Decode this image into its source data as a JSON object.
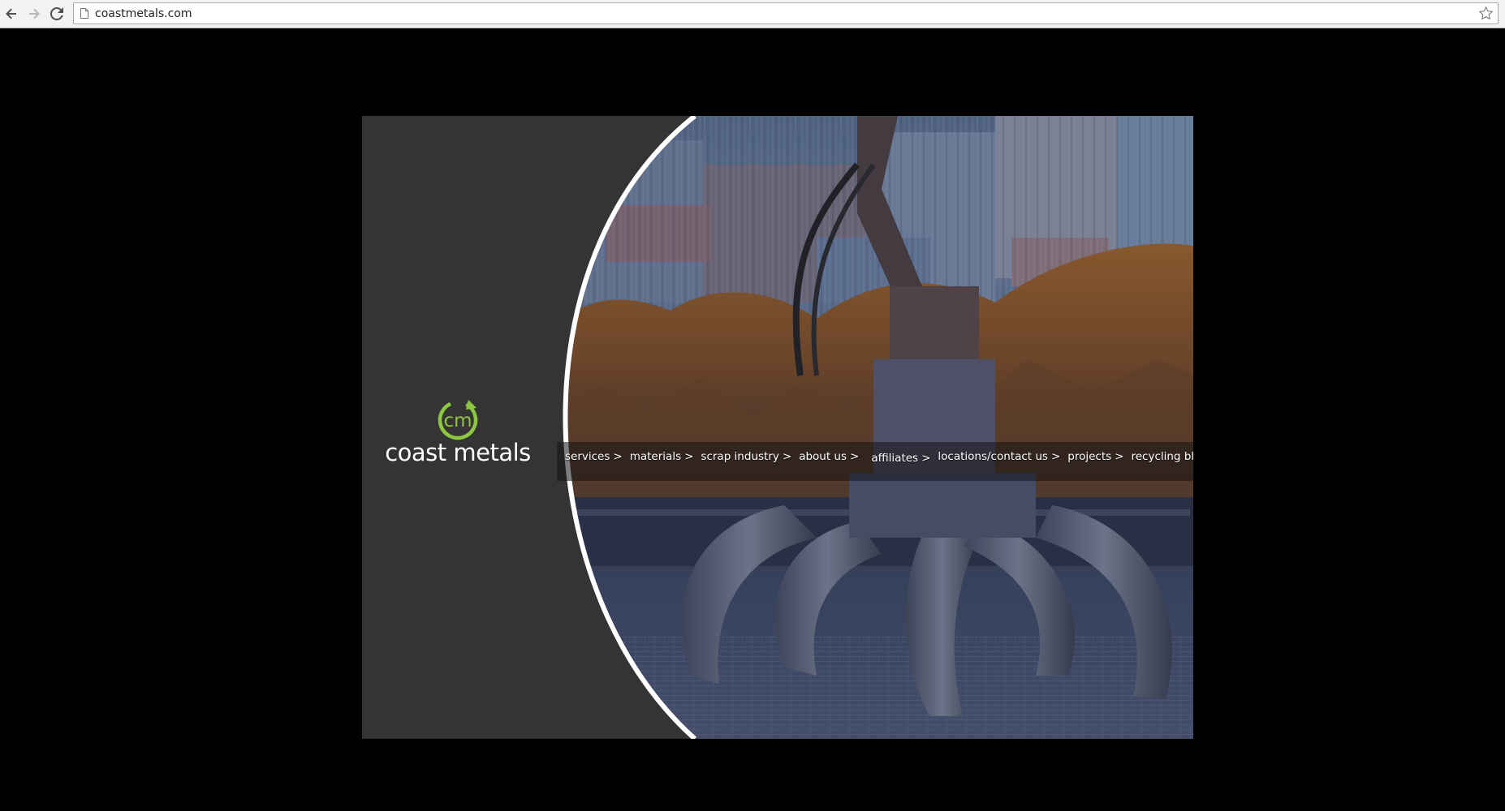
{
  "browser": {
    "url": "coastmetals.com",
    "icons": {
      "back": "arrow-left-icon",
      "forward": "arrow-right-icon",
      "reload": "reload-icon",
      "page": "page-icon",
      "bookmark": "star-icon"
    }
  },
  "site": {
    "logo": {
      "monogram": "cm",
      "name": "coast metals",
      "accent_color": "#8dc63f"
    },
    "colors": {
      "background": "#000000",
      "panel": "#343434",
      "arc": "#ffffff"
    },
    "nav": [
      {
        "label": "services",
        "arrow": ">"
      },
      {
        "label": "materials",
        "arrow": ">"
      },
      {
        "label": "scrap industry",
        "arrow": ">"
      },
      {
        "label": "about us",
        "arrow": ">"
      },
      {
        "label": "affiliates",
        "arrow": ">"
      },
      {
        "label": "locations/contact us",
        "arrow": ">"
      },
      {
        "label": "projects",
        "arrow": ">"
      },
      {
        "label": "recycling blog",
        "arrow": ">"
      }
    ]
  }
}
